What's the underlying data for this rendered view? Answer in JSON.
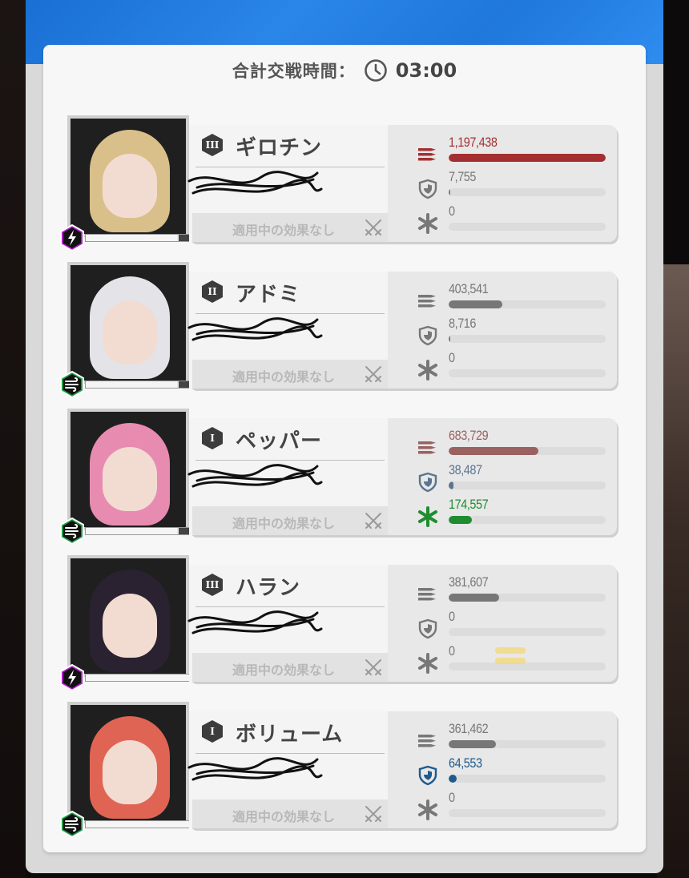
{
  "header": {
    "label": "合計交戦時間：",
    "time": "03:00"
  },
  "effect_text": "適用中の効果なし",
  "characters": [
    {
      "name": "ギロチン",
      "rank": "III",
      "element": "electric",
      "element_color": "#b01cc9",
      "hair_color": "#d9c08a",
      "hp_fraction": 0.88,
      "stats": [
        {
          "type": "damage",
          "value": "1,197,438",
          "fraction": 1.0,
          "color": "#a42f31"
        },
        {
          "type": "shield",
          "value": "7,755",
          "fraction": 0.005,
          "color": "#777777"
        },
        {
          "type": "heal",
          "value": "0",
          "fraction": 0,
          "color": "#777777"
        }
      ]
    },
    {
      "name": "アドミ",
      "rank": "II",
      "element": "wind",
      "element_color": "#1d9a46",
      "hair_color": "#e3e3e8",
      "hp_fraction": 0.88,
      "stats": [
        {
          "type": "damage",
          "value": "403,541",
          "fraction": 0.34,
          "color": "#777777"
        },
        {
          "type": "shield",
          "value": "8,716",
          "fraction": 0.005,
          "color": "#777777"
        },
        {
          "type": "heal",
          "value": "0",
          "fraction": 0,
          "color": "#777777"
        }
      ]
    },
    {
      "name": "ペッパー",
      "rank": "I",
      "element": "wind",
      "element_color": "#1d9a46",
      "hair_color": "#e88bb0",
      "hp_fraction": 0.88,
      "stats": [
        {
          "type": "damage",
          "value": "683,729",
          "fraction": 0.57,
          "color": "#9a6161"
        },
        {
          "type": "shield",
          "value": "38,487",
          "fraction": 0.03,
          "color": "#5a7590"
        },
        {
          "type": "heal",
          "value": "174,557",
          "fraction": 0.15,
          "color": "#1f8d2f"
        }
      ]
    },
    {
      "name": "ハラン",
      "rank": "III",
      "element": "electric",
      "element_color": "#b01cc9",
      "hair_color": "#2a2231",
      "hp_fraction": 0.99,
      "stats": [
        {
          "type": "damage",
          "value": "381,607",
          "fraction": 0.32,
          "color": "#777777"
        },
        {
          "type": "shield",
          "value": "0",
          "fraction": 0,
          "color": "#777777"
        },
        {
          "type": "heal",
          "value": "0",
          "fraction": 0,
          "color": "#777777"
        }
      ]
    },
    {
      "name": "ボリューム",
      "rank": "I",
      "element": "wind",
      "element_color": "#1d9a46",
      "hair_color": "#e06454",
      "hp_fraction": 0.99,
      "stats": [
        {
          "type": "damage",
          "value": "361,462",
          "fraction": 0.3,
          "color": "#777777"
        },
        {
          "type": "shield",
          "value": "64,553",
          "fraction": 0.05,
          "color": "#1e5a8e"
        },
        {
          "type": "heal",
          "value": "0",
          "fraction": 0,
          "color": "#777777"
        }
      ]
    }
  ]
}
